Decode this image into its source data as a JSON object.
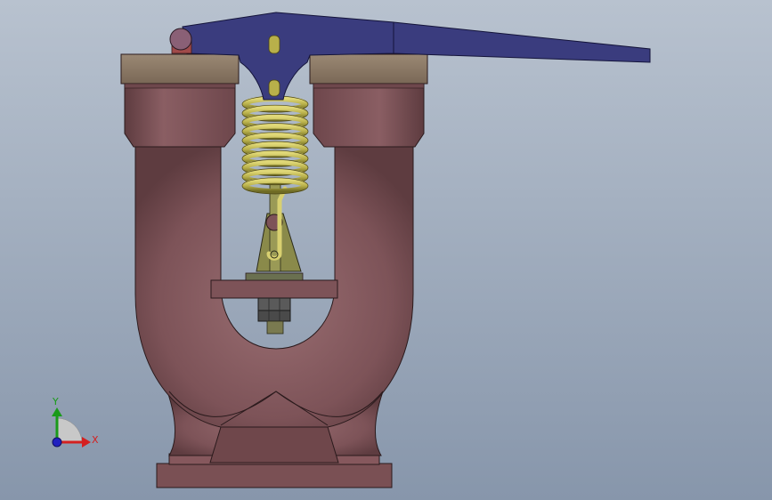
{
  "viewport": {
    "background_top": "#b8c2cf",
    "background_bottom": "#8796ab"
  },
  "model": {
    "body_color": "#7f555a",
    "flange_color": "#8a7866",
    "lever_color": "#3a3c7e",
    "spring_color": "#b8b04a",
    "stem_color": "#8a8a4a",
    "nut_color": "#4a4a4a"
  },
  "triad": {
    "x_label": "X",
    "y_label": "Y",
    "x_color": "#d42020",
    "y_color": "#1a9a1a",
    "z_color": "#2020c0"
  }
}
